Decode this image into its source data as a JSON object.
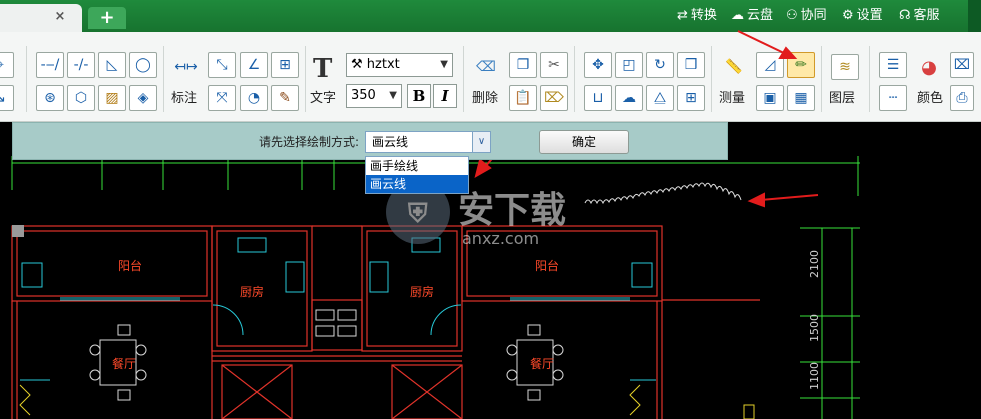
{
  "titlebar": {
    "tab_close": "×",
    "tab_add": "+",
    "menu": [
      {
        "label": "转换",
        "icon": "convert-icon",
        "glyph": "⇄"
      },
      {
        "label": "云盘",
        "icon": "cloud-icon",
        "glyph": "☁"
      },
      {
        "label": "协同",
        "icon": "collaborate-icon",
        "glyph": "⚇"
      },
      {
        "label": "设置",
        "icon": "settings-icon",
        "glyph": "⚙"
      },
      {
        "label": "客服",
        "icon": "headset-icon",
        "glyph": "☊"
      }
    ]
  },
  "ribbon": {
    "dim_label": "标注",
    "text_label": "文字",
    "delete_label": "删除",
    "measure_label": "测量",
    "layer_label": "图层",
    "color_label": "颜色",
    "font_name": "hztxt",
    "font_size": "350",
    "bold": "B",
    "italic": "I",
    "big_t": "T"
  },
  "prompt": {
    "label": "请先选择绘制方式:",
    "combo_value": "画云线",
    "ok_label": "确定",
    "options": [
      "画手绘线",
      "画云线"
    ]
  },
  "drawing": {
    "rooms": [
      {
        "label": "阳台"
      },
      {
        "label": "厨房"
      },
      {
        "label": "厨房"
      },
      {
        "label": "阳台"
      },
      {
        "label": "餐厅"
      },
      {
        "label": "餐厅"
      }
    ],
    "dims": [
      "2100",
      "1500",
      "1100"
    ],
    "watermark": "安下载",
    "watermark_url": "anxz.com"
  },
  "colors": {
    "title_green": "#1f8a3c",
    "wall_red": "#e0332a",
    "dim_green": "#37e23a",
    "cyan": "#27c9d8",
    "arrow_red": "#e21c1c"
  }
}
